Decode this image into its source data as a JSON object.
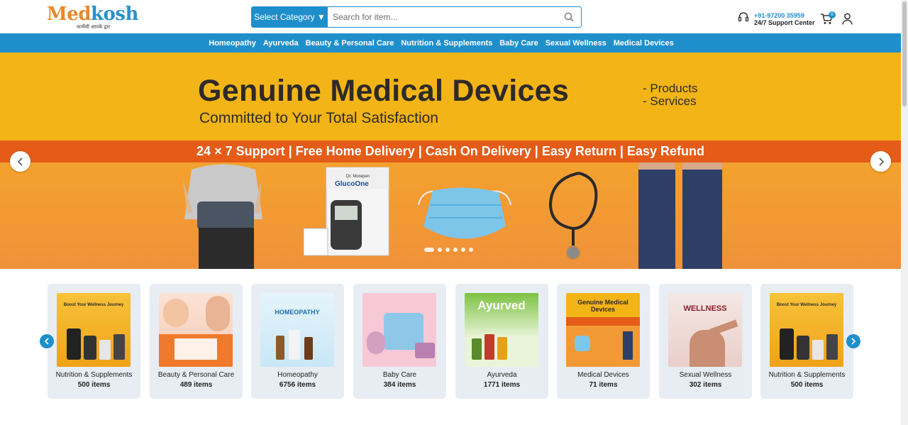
{
  "header": {
    "logo_part1": "Med",
    "logo_part2": "kosh",
    "logo_tagline": "फार्मेसी आपके द्वार",
    "category_button": "Select Category ▼",
    "search_placeholder": "Search for item...",
    "support_phone": "+91-97200 35959",
    "support_label": "24/7 Support Center",
    "cart_count": "0"
  },
  "nav": {
    "items": [
      "Homeopathy",
      "Ayurveda",
      "Beauty & Personal Care",
      "Nutrition & Supplements",
      "Baby Care",
      "Sexual Wellness",
      "Medical Devices"
    ]
  },
  "banner": {
    "title": "Genuine Medical Devices",
    "subtitle": "Committed to Your Total Satisfaction",
    "side_1": "- Products",
    "side_2": "- Services",
    "strip": "24 × 7 Support | Free Home Delivery | Cash On Delivery | Easy Return | Easy Refund",
    "product_brand": "Dr. Morepen",
    "product_name": "GlucoOne",
    "slide_count": 6,
    "active_slide": 1
  },
  "categories": [
    {
      "name": "Nutrition & Supplements",
      "count": "500 items",
      "img_title": "Boost Your Wellness Journey"
    },
    {
      "name": "Beauty & Personal Care",
      "count": "489 items",
      "img_title": ""
    },
    {
      "name": "Homeopathy",
      "count": "6756 items",
      "img_title": "HOMEOPATHY"
    },
    {
      "name": "Baby Care",
      "count": "384 items",
      "img_title": ""
    },
    {
      "name": "Ayurveda",
      "count": "1771 items",
      "img_title": "Ayurved"
    },
    {
      "name": "Medical Devices",
      "count": "71 items",
      "img_title": "Genuine Medical Devices"
    },
    {
      "name": "Sexual Wellness",
      "count": "302 items",
      "img_title": "WELLNESS"
    },
    {
      "name": "Nutrition & Supplements",
      "count": "500 items",
      "img_title": "Boost Your Wellness Journey"
    }
  ],
  "colors": {
    "primary": "#1f8fcc",
    "banner_yellow": "#f2b416",
    "banner_orange": "#e45c18",
    "card_bg": "#e8edf3"
  }
}
